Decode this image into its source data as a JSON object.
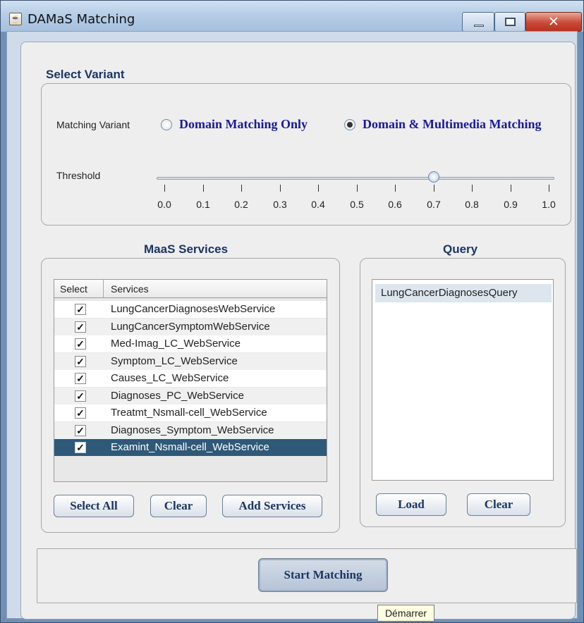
{
  "window": {
    "title": "DAMaS Matching"
  },
  "select_variant": {
    "title": "Select Variant",
    "matching_variant_label": "Matching Variant",
    "options": [
      "Domain Matching Only",
      "Domain & Multimedia Matching"
    ],
    "selected_index": 1,
    "threshold_label": "Threshold",
    "threshold_value": 0.7,
    "tick_labels": [
      "0.0",
      "0.1",
      "0.2",
      "0.3",
      "0.4",
      "0.5",
      "0.6",
      "0.7",
      "0.8",
      "0.9",
      "1.0"
    ]
  },
  "services": {
    "title": "MaaS Services",
    "columns": [
      "Select",
      "Services"
    ],
    "rows": [
      {
        "checked": true,
        "name": "LungCancerDiagnosesWebService"
      },
      {
        "checked": true,
        "name": "LungCancerSymptomWebService"
      },
      {
        "checked": true,
        "name": "Med-Imag_LC_WebService"
      },
      {
        "checked": true,
        "name": "Symptom_LC_WebService"
      },
      {
        "checked": true,
        "name": "Causes_LC_WebService"
      },
      {
        "checked": true,
        "name": "Diagnoses_PC_WebService"
      },
      {
        "checked": true,
        "name": "Treatmt_Nsmall-cell_WebService"
      },
      {
        "checked": true,
        "name": "Diagnoses_Symptom_WebService"
      },
      {
        "checked": true,
        "name": "Examint_Nsmall-cell_WebService",
        "selected": true
      }
    ],
    "buttons": {
      "select_all": "Select All",
      "clear": "Clear",
      "add_services": "Add Services"
    }
  },
  "query": {
    "title": "Query",
    "items": [
      "LungCancerDiagnosesQuery"
    ],
    "buttons": {
      "load": "Load",
      "clear": "Clear"
    }
  },
  "start_button": "Start Matching",
  "tooltip": "Démarrer",
  "colors": {
    "title_blue": "#1c3561",
    "radio_label_blue": "#1a1a9a",
    "selection": "#2f5979"
  }
}
